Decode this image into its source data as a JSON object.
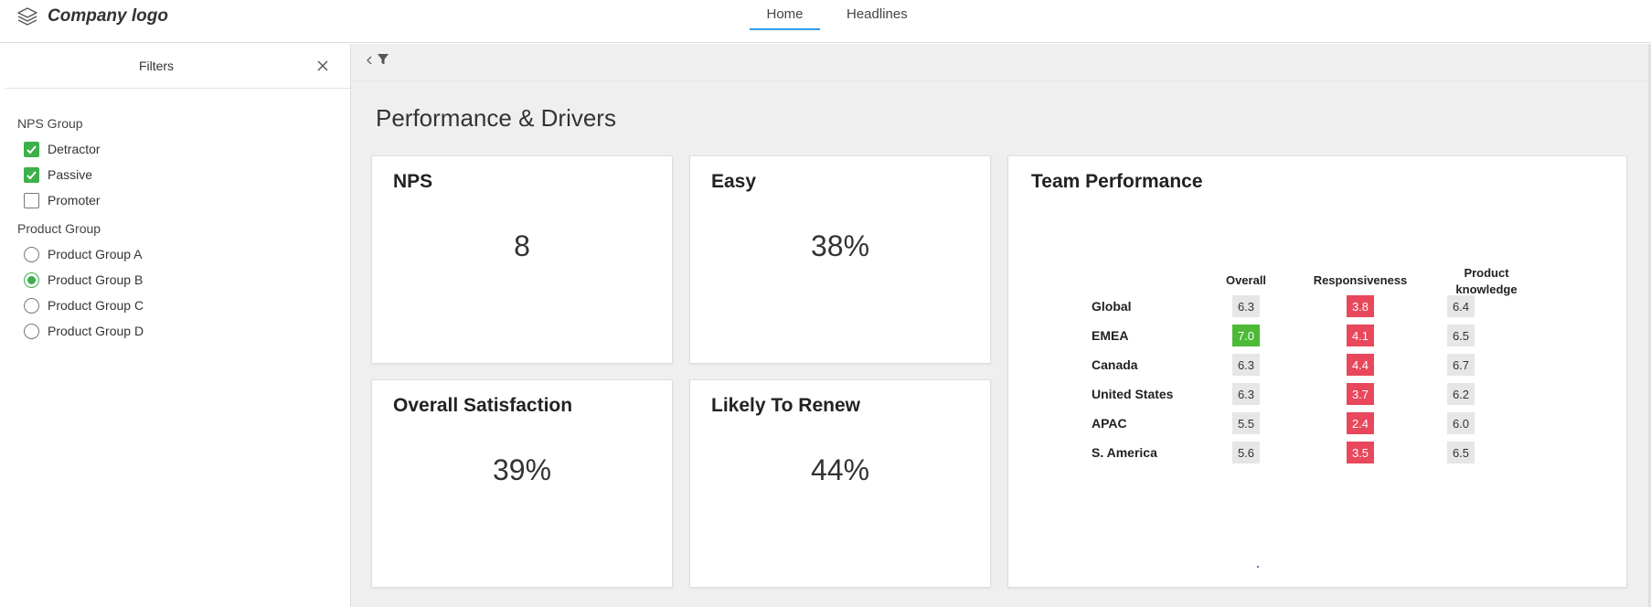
{
  "app": {
    "logo_text": "Company logo",
    "tabs": [
      {
        "label": "Home",
        "active": true
      },
      {
        "label": "Headlines",
        "active": false
      }
    ]
  },
  "filters": {
    "title": "Filters",
    "nps_group": {
      "label": "NPS Group",
      "options": [
        {
          "label": "Detractor",
          "checked": true
        },
        {
          "label": "Passive",
          "checked": true
        },
        {
          "label": "Promoter",
          "checked": false
        }
      ]
    },
    "product_group": {
      "label": "Product Group",
      "options": [
        {
          "label": "Product Group A",
          "selected": false
        },
        {
          "label": "Product Group B",
          "selected": true
        },
        {
          "label": "Product Group C",
          "selected": false
        },
        {
          "label": "Product Group D",
          "selected": false
        }
      ]
    }
  },
  "main": {
    "title": "Performance & Drivers",
    "cards": [
      {
        "title": "NPS",
        "value": "8"
      },
      {
        "title": "Easy",
        "value": "38%"
      },
      {
        "title": "Overall Satisfaction",
        "value": "39%"
      },
      {
        "title": "Likely To Renew",
        "value": "44%"
      }
    ]
  },
  "team_performance": {
    "title": "Team Performance",
    "columns": [
      "Overall",
      "Responsiveness",
      "Product knowledge"
    ],
    "rows": [
      {
        "region": "Global",
        "values": [
          "6.3",
          "3.8",
          "6.4"
        ],
        "status": [
          "neutral",
          "bad",
          "neutral"
        ]
      },
      {
        "region": "EMEA",
        "values": [
          "7.0",
          "4.1",
          "6.5"
        ],
        "status": [
          "good",
          "bad",
          "neutral"
        ]
      },
      {
        "region": "Canada",
        "values": [
          "6.3",
          "4.4",
          "6.7"
        ],
        "status": [
          "neutral",
          "bad",
          "neutral"
        ]
      },
      {
        "region": "United States",
        "values": [
          "6.3",
          "3.7",
          "6.2"
        ],
        "status": [
          "neutral",
          "bad",
          "neutral"
        ]
      },
      {
        "region": "APAC",
        "values": [
          "5.5",
          "2.4",
          "6.0"
        ],
        "status": [
          "neutral",
          "bad",
          "neutral"
        ]
      },
      {
        "region": "S. America",
        "values": [
          "5.6",
          "3.5",
          "6.5"
        ],
        "status": [
          "neutral",
          "bad",
          "neutral"
        ]
      }
    ]
  },
  "colors": {
    "accent": "#2b9fe5",
    "check_green": "#3db04a",
    "good": "#4cb937",
    "bad": "#e8475c",
    "neutral": "#e6e6e6"
  },
  "icons": [
    "layers-icon",
    "close-icon",
    "chevron-left-icon",
    "filter-icon",
    "check-icon"
  ]
}
